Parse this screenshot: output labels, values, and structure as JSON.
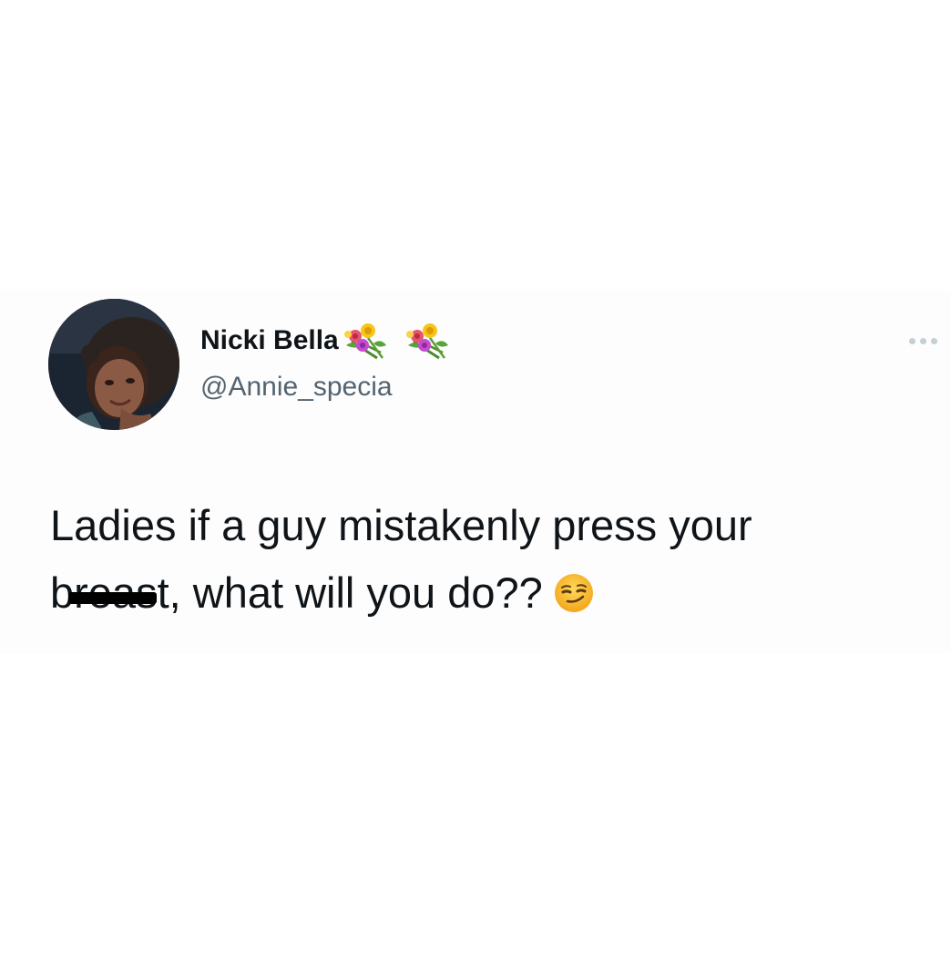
{
  "tweet": {
    "author": {
      "display_name": "Nicki Bella",
      "handle": "@Annie_specia",
      "name_icons": [
        "bouquet-icon",
        "bouquet-icon"
      ],
      "avatar": "profile-photo"
    },
    "text": {
      "line1": "Ladies if a guy mistakenly press your",
      "line2_censored_word": "breast",
      "line2_rest": ", what will you do??",
      "trailing_emoji": "smirking-face-icon"
    },
    "more_menu_icon": "more-horizontal-icon",
    "colors": {
      "text_primary": "#0f1419",
      "text_secondary": "#536471",
      "more_dots": "#c4cfd6",
      "card_background": "#fdfdfd"
    }
  }
}
